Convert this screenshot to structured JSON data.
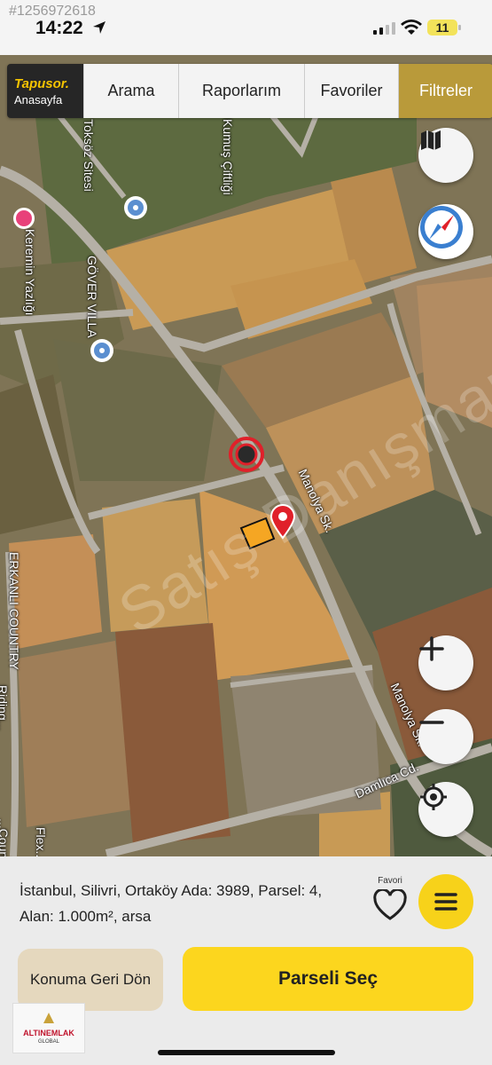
{
  "status_bar": {
    "listing_id": "#1256972618",
    "time": "14:22",
    "battery": "11"
  },
  "nav": {
    "brand_logo": "Tapusor.",
    "brand_sub": "Anasayfa",
    "tabs": [
      {
        "label": "Arama"
      },
      {
        "label": "Raporlarım"
      },
      {
        "label": "Favoriler"
      },
      {
        "label": "Filtreler",
        "active": true
      }
    ]
  },
  "map": {
    "labels": {
      "toksoz": "Toksöz Sitesi",
      "kumus": "Kumuş Çiftliği",
      "keremin": "Keremin Yazlığı",
      "gover": "GÖVER VILLA",
      "manolya1": "Manolya Sk.",
      "manolya2": "Manolya Sk.",
      "damlica": "Damlıca Cd.",
      "erkanli": "ERKANLI COUNTRY",
      "riding": "Riding...",
      "flex": "Flex...",
      "country2": "...Count..."
    },
    "watermark": "Satış Danışmanı"
  },
  "parcel": {
    "info": "İstanbul, Silivri, Ortaköy Ada: 3989, Parsel: 4, Alan: 1.000m², arsa"
  },
  "favorite": {
    "label": "Favori"
  },
  "buttons": {
    "back": "Konuma Geri Dön",
    "select": "Parseli Seç"
  },
  "agency": {
    "name": "ALTINEMLAK",
    "sub": "GLOBAL"
  },
  "colors": {
    "accent_yellow": "#fcd61e",
    "active_tab": "#b99a3a",
    "pin_red": "#e0202a",
    "parcel_orange": "#f5a623"
  },
  "icons": [
    "location-arrow-icon",
    "signal-icon",
    "wifi-icon",
    "map-layers-icon",
    "compass-icon",
    "zoom-in-icon",
    "zoom-out-icon",
    "locate-icon",
    "heart-icon",
    "menu-icon",
    "pin-icon"
  ]
}
